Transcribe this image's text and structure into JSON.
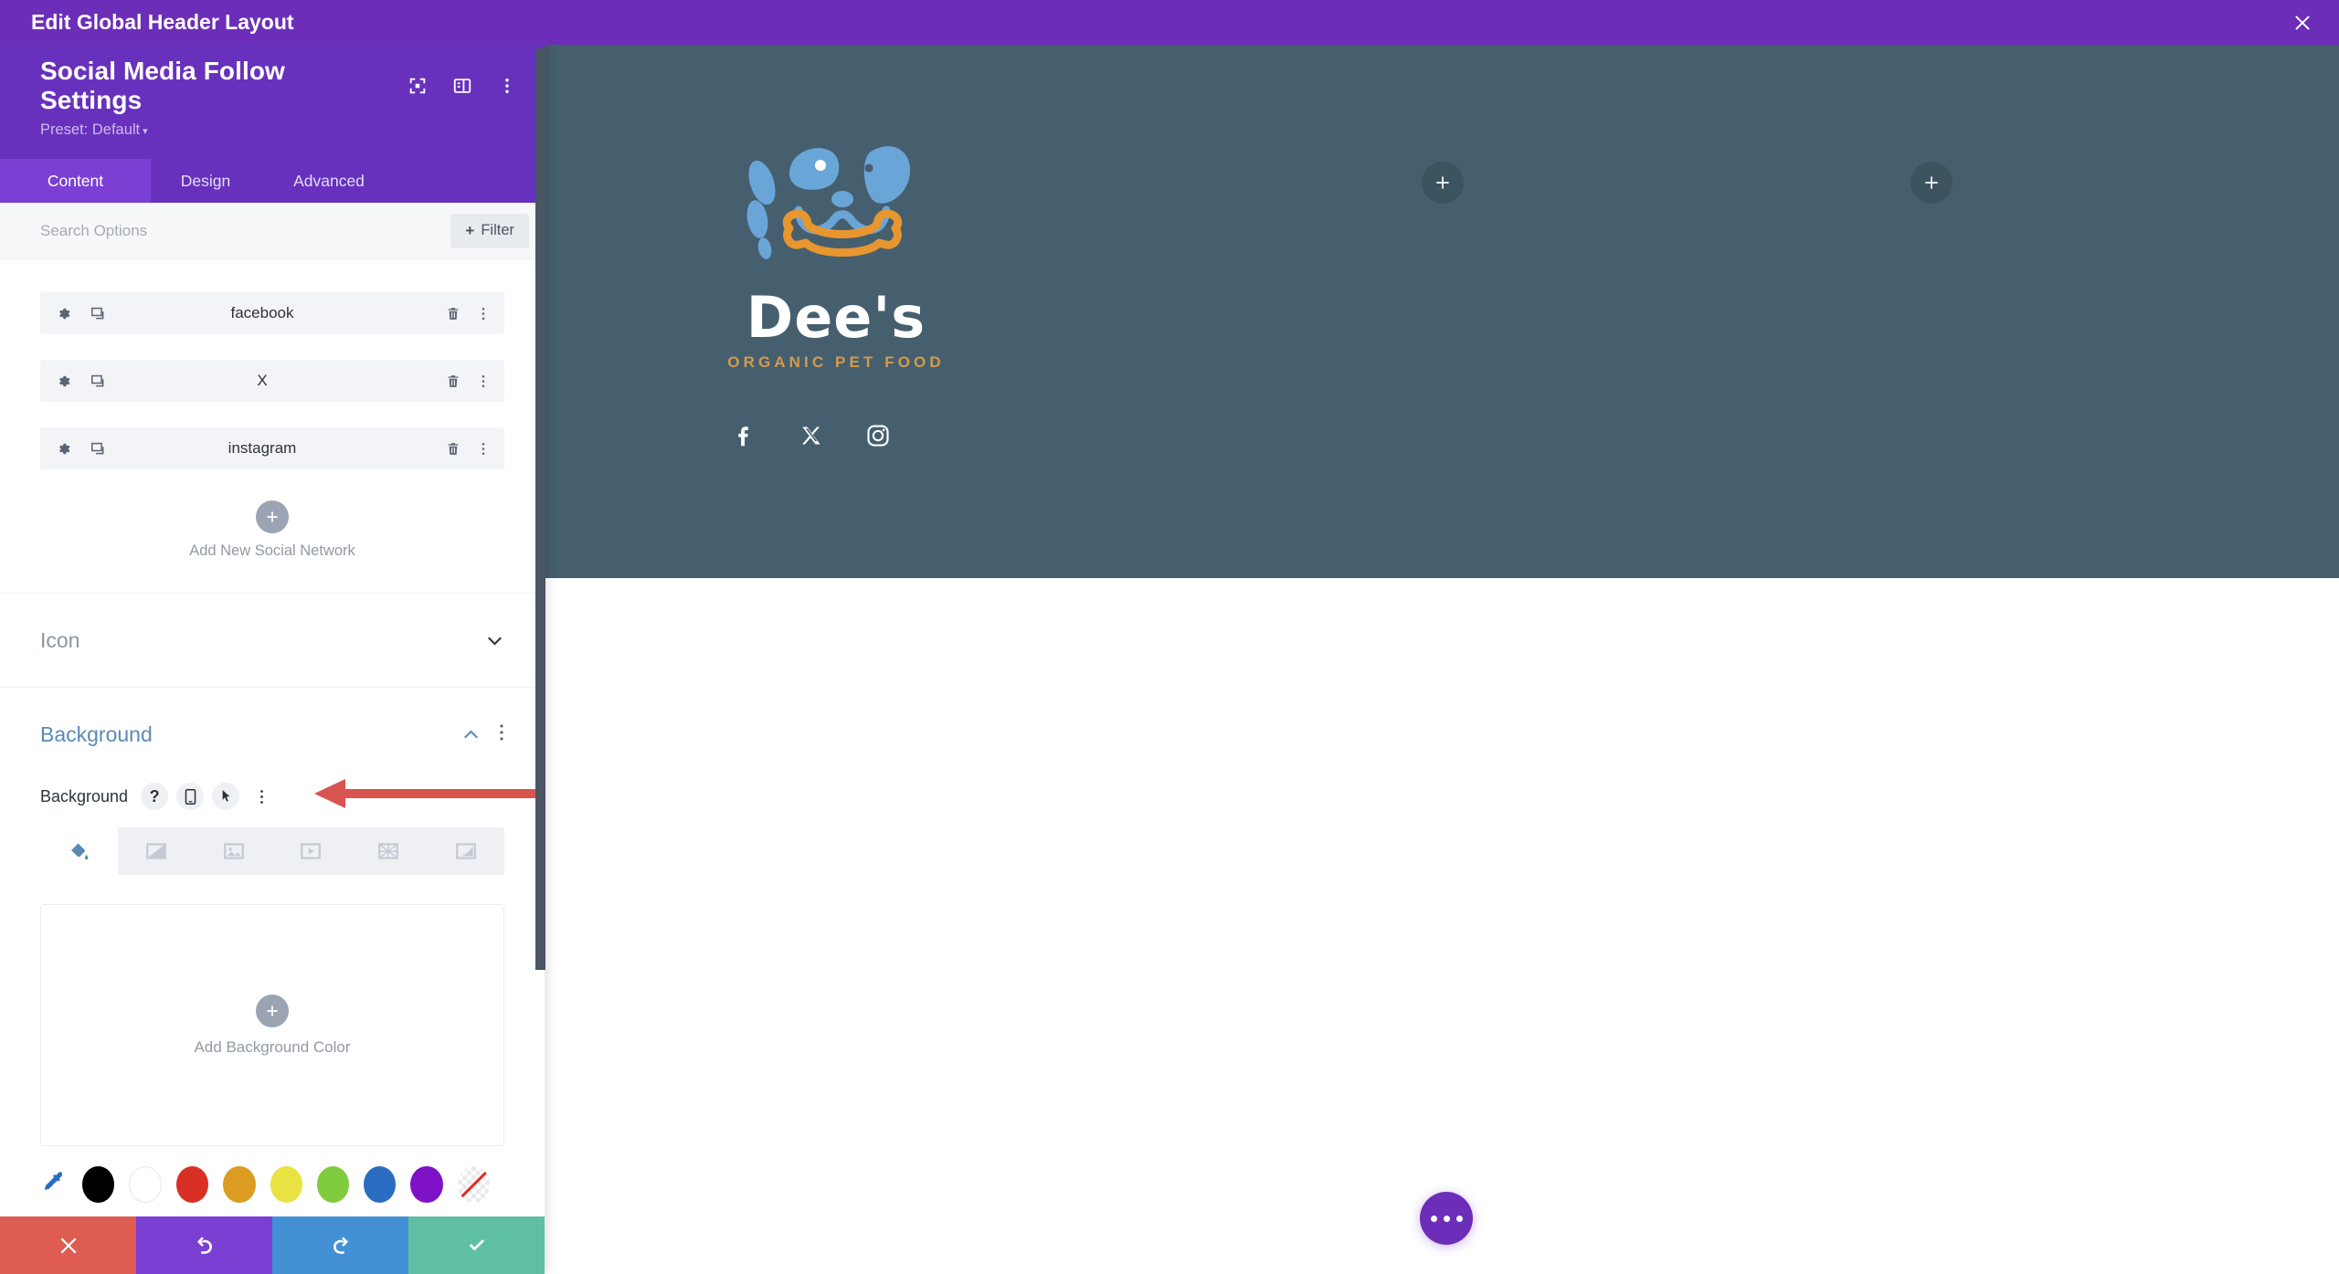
{
  "window": {
    "title": "Edit Global Header Layout",
    "close_icon": "close-icon",
    "titlebar_color": "#6c2eb9"
  },
  "modal": {
    "title": "Social Media Follow Settings",
    "preset_label": "Preset: Default",
    "header_icons": [
      "focus-module-icon",
      "layout-panel-icon",
      "kebab-menu-icon"
    ],
    "tabs": [
      {
        "label": "Content",
        "active": true
      },
      {
        "label": "Design",
        "active": false
      },
      {
        "label": "Advanced",
        "active": false
      }
    ]
  },
  "search": {
    "placeholder": "Search Options",
    "value": "",
    "filter_label": "Filter",
    "filter_plus": "+"
  },
  "social_list": {
    "items": [
      {
        "label": "facebook"
      },
      {
        "label": "X"
      },
      {
        "label": "instagram"
      }
    ],
    "row_icons_left": [
      "gear-icon",
      "duplicate-icon"
    ],
    "row_icons_right": [
      "trash-icon",
      "kebab-menu-icon"
    ],
    "add_label": "Add New Social Network",
    "add_plus": "+"
  },
  "annotation": {
    "arrow_color": "#d9534f",
    "points_at": "add-new-social-network-button"
  },
  "sections": [
    {
      "key": "icon",
      "title": "Icon",
      "open": false
    },
    {
      "key": "background",
      "title": "Background",
      "open": true
    }
  ],
  "background": {
    "field_label": "Background",
    "field_icons": [
      "help-icon",
      "mobile-icon",
      "hover-pointer-icon",
      "kebab-menu-icon"
    ],
    "types": [
      {
        "name": "background-color-icon",
        "selected": true
      },
      {
        "name": "background-gradient-icon",
        "selected": false
      },
      {
        "name": "background-image-icon",
        "selected": false
      },
      {
        "name": "background-video-icon",
        "selected": false
      },
      {
        "name": "background-pattern-icon",
        "selected": false
      },
      {
        "name": "background-mask-icon",
        "selected": false
      }
    ],
    "add_color_label": "Add Background Color",
    "add_color_plus": "+",
    "swatches": [
      {
        "name": "eyedropper",
        "color": "eyedropper"
      },
      {
        "name": "black",
        "color": "#000000"
      },
      {
        "name": "white",
        "color": "#ffffff"
      },
      {
        "name": "red",
        "color": "#d93025"
      },
      {
        "name": "orange",
        "color": "#dc9b21"
      },
      {
        "name": "yellow",
        "color": "#e8e342"
      },
      {
        "name": "green",
        "color": "#80cb3e"
      },
      {
        "name": "blue",
        "color": "#2a6dc0"
      },
      {
        "name": "purple",
        "color": "#7f11c7"
      },
      {
        "name": "transparent",
        "color": "transparent"
      }
    ]
  },
  "bottom_actions": [
    {
      "name": "cancel",
      "icon": "x-icon",
      "color": "#de5c52"
    },
    {
      "name": "undo",
      "icon": "undo-icon",
      "color": "#7b3fd4"
    },
    {
      "name": "redo",
      "icon": "redo-icon",
      "color": "#4490d4"
    },
    {
      "name": "save",
      "icon": "checkmark-icon",
      "color": "#5fbfa5"
    }
  ],
  "preview": {
    "band_color": "#455f6e",
    "logo": {
      "wordmark": "Dee's",
      "tagline": "ORGANIC PET FOOD",
      "mark_colors": {
        "dog": "#6aa5d8",
        "bone": "#e8962e"
      }
    },
    "social_icons": [
      "facebook-icon",
      "x-twitter-icon",
      "instagram-icon"
    ],
    "add_module_buttons": [
      "add-module-plus-left",
      "add-module-plus-right"
    ],
    "fab": {
      "name": "page-settings-fab",
      "icon": "ellipsis-icon",
      "color": "#6c2eb9"
    }
  }
}
